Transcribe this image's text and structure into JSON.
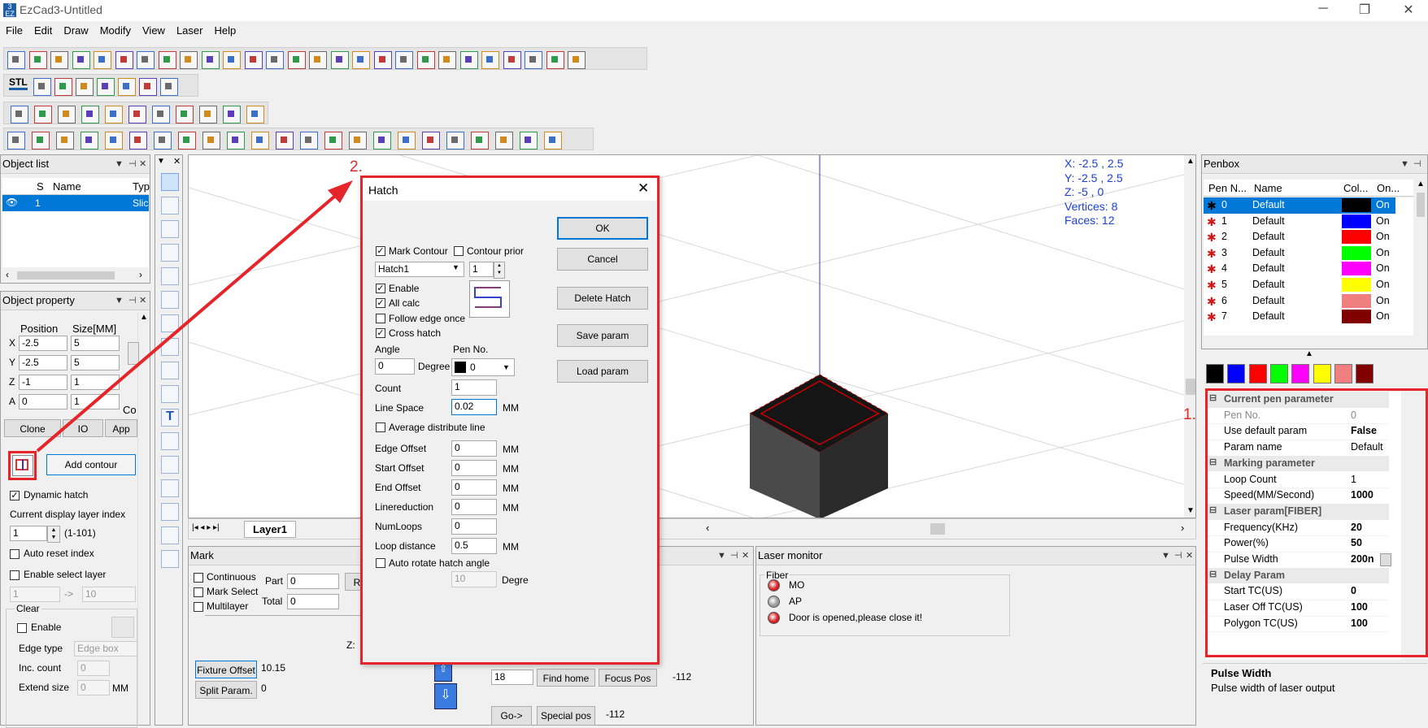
{
  "window": {
    "title": "EzCad3-Untitled",
    "icon_text": "3\nEZCAD"
  },
  "menu": [
    "File",
    "Edit",
    "Draw",
    "Modify",
    "View",
    "Laser",
    "Help"
  ],
  "toolbar": {
    "stl_label": "STL"
  },
  "object_list": {
    "title": "Object list",
    "columns": [
      "S",
      "Name",
      "Typ"
    ],
    "rows": [
      {
        "s": "1",
        "name": "",
        "type": "Slic"
      }
    ]
  },
  "object_property": {
    "title": "Object property",
    "position_label": "Position",
    "size_label": "Size[MM]",
    "rows": [
      {
        "axis": "X",
        "pos": "-2.5",
        "size": "5"
      },
      {
        "axis": "Y",
        "pos": "-2.5",
        "size": "5"
      },
      {
        "axis": "Z",
        "pos": "-1",
        "size": "1"
      },
      {
        "axis": "A",
        "pos": "0",
        "size": "1"
      }
    ],
    "co_label": "Co",
    "buttons": [
      "Clone",
      "IO",
      "App"
    ],
    "add_contour": "Add contour",
    "dynamic_hatch": "Dynamic hatch",
    "layer_index_label": "Current display layer index",
    "layer_index": "1",
    "layer_range": "(1-101)",
    "auto_reset": "Auto reset index",
    "enable_select_layer": "Enable select layer",
    "sel_from": "1",
    "sel_arrow": "->",
    "sel_to": "10",
    "clear_label": "Clear",
    "enable_label": "Enable",
    "edge_type_label": "Edge type",
    "edge_type_value": "Edge box",
    "inc_count_label": "Inc. count",
    "inc_count_value": "0",
    "extend_size_label": "Extend size",
    "extend_size_value": "0",
    "mm": "MM"
  },
  "viewport": {
    "info": [
      "X: -2.5 , 2.5",
      "Y: -2.5 , 2.5",
      "Z: -5 , 0",
      "Vertices: 8",
      "Faces: 12"
    ],
    "layer_tab": "Layer1"
  },
  "hatch": {
    "title": "Hatch",
    "mark_contour": "Mark Contour",
    "contour_prior": "Contour prior",
    "hatch_select": "Hatch1",
    "hatch_num": "1",
    "enable": "Enable",
    "all_calc": "All calc",
    "follow_edge": "Follow edge once",
    "cross_hatch": "Cross hatch",
    "angle_label": "Angle",
    "angle_value": "0",
    "degree": "Degree",
    "pen_no_label": "Pen No.",
    "pen_no_value": "0",
    "count_label": "Count",
    "count_value": "1",
    "line_space_label": "Line Space",
    "line_space_value": "0.02",
    "avg_line": "Average distribute line",
    "params": [
      {
        "label": "Edge Offset",
        "value": "0",
        "unit": "MM"
      },
      {
        "label": "Start Offset",
        "value": "0",
        "unit": "MM"
      },
      {
        "label": "End Offset",
        "value": "0",
        "unit": "MM"
      },
      {
        "label": "Linereduction",
        "value": "0",
        "unit": "MM"
      },
      {
        "label": "NumLoops",
        "value": "0",
        "unit": ""
      },
      {
        "label": "Loop distance",
        "value": "0.5",
        "unit": "MM"
      }
    ],
    "auto_rotate": "Auto rotate hatch angle",
    "rotate_value": "10",
    "rotate_unit": "Degre",
    "buttons": [
      "OK",
      "Cancel",
      "Delete Hatch",
      "Save param",
      "Load param"
    ],
    "mm": "MM"
  },
  "mark": {
    "title": "Mark",
    "continuous": "Continuous",
    "mark_select": "Mark Select",
    "multilayer": "Multilayer",
    "part_label": "Part",
    "part_value": "0",
    "total_label": "Total",
    "total_value": "0",
    "r_btn": "R",
    "z_label": "Z:",
    "fixture_offset": "Fixture Offset",
    "fixture_value": "10.15",
    "split_param": "Split Param.",
    "split_value": "0",
    "step_value": "18",
    "find_home": "Find home",
    "focus_pos": "Focus Pos",
    "focus_value": "-112",
    "go": "Go->",
    "special_pos": "Special pos",
    "special_value": "-112"
  },
  "laser_monitor": {
    "title": "Laser monitor",
    "group": "Fiber",
    "items": [
      {
        "label": "MO",
        "state": "red"
      },
      {
        "label": "AP",
        "state": "gray"
      },
      {
        "label": "Door is opened,please close it!",
        "state": "red"
      }
    ]
  },
  "penbox": {
    "title": "Penbox",
    "columns": [
      "Pen N...",
      "Name",
      "Col...",
      "On..."
    ],
    "pens": [
      {
        "no": "0",
        "name": "Default",
        "color": "#000000",
        "on": "On"
      },
      {
        "no": "1",
        "name": "Default",
        "color": "#0000ff",
        "on": "On"
      },
      {
        "no": "2",
        "name": "Default",
        "color": "#ff0000",
        "on": "On"
      },
      {
        "no": "3",
        "name": "Default",
        "color": "#00ff00",
        "on": "On"
      },
      {
        "no": "4",
        "name": "Default",
        "color": "#ff00ff",
        "on": "On"
      },
      {
        "no": "5",
        "name": "Default",
        "color": "#ffff00",
        "on": "On"
      },
      {
        "no": "6",
        "name": "Default",
        "color": "#f08080",
        "on": "On"
      },
      {
        "no": "7",
        "name": "Default",
        "color": "#800000",
        "on": "On"
      }
    ],
    "swatches": [
      "#000000",
      "#0000ff",
      "#ff0000",
      "#00ff00",
      "#ff00ff",
      "#ffff00",
      "#f08080",
      "#800000"
    ]
  },
  "pen_params": {
    "sections": [
      {
        "title": "Current pen parameter",
        "rows": [
          {
            "name": "Pen No.",
            "value": "0",
            "dim": true
          },
          {
            "name": "Use default param",
            "value": "False"
          },
          {
            "name": "Param name",
            "value": "Default",
            "normal": true
          }
        ]
      },
      {
        "title": "Marking parameter",
        "rows": [
          {
            "name": "Loop Count",
            "value": "1",
            "normal": true
          },
          {
            "name": "Speed(MM/Second)",
            "value": "1000"
          }
        ]
      },
      {
        "title": "Laser param[FIBER]",
        "rows": [
          {
            "name": "Frequency(KHz)",
            "value": "20"
          },
          {
            "name": "Power(%)",
            "value": "50"
          },
          {
            "name": "Pulse Width",
            "value": "200n"
          }
        ]
      },
      {
        "title": "Delay Param",
        "rows": [
          {
            "name": "Start TC(US)",
            "value": "0"
          },
          {
            "name": "Laser Off TC(US)",
            "value": "100"
          },
          {
            "name": "Polygon TC(US)",
            "value": "100"
          }
        ]
      }
    ],
    "desc_title": "Pulse Width",
    "desc_text": "Pulse width of laser output"
  },
  "annotations": {
    "label1": "1.",
    "label2": "2."
  },
  "colors": {
    "accent_red": "#e5252a",
    "selection": "#0078d7"
  }
}
